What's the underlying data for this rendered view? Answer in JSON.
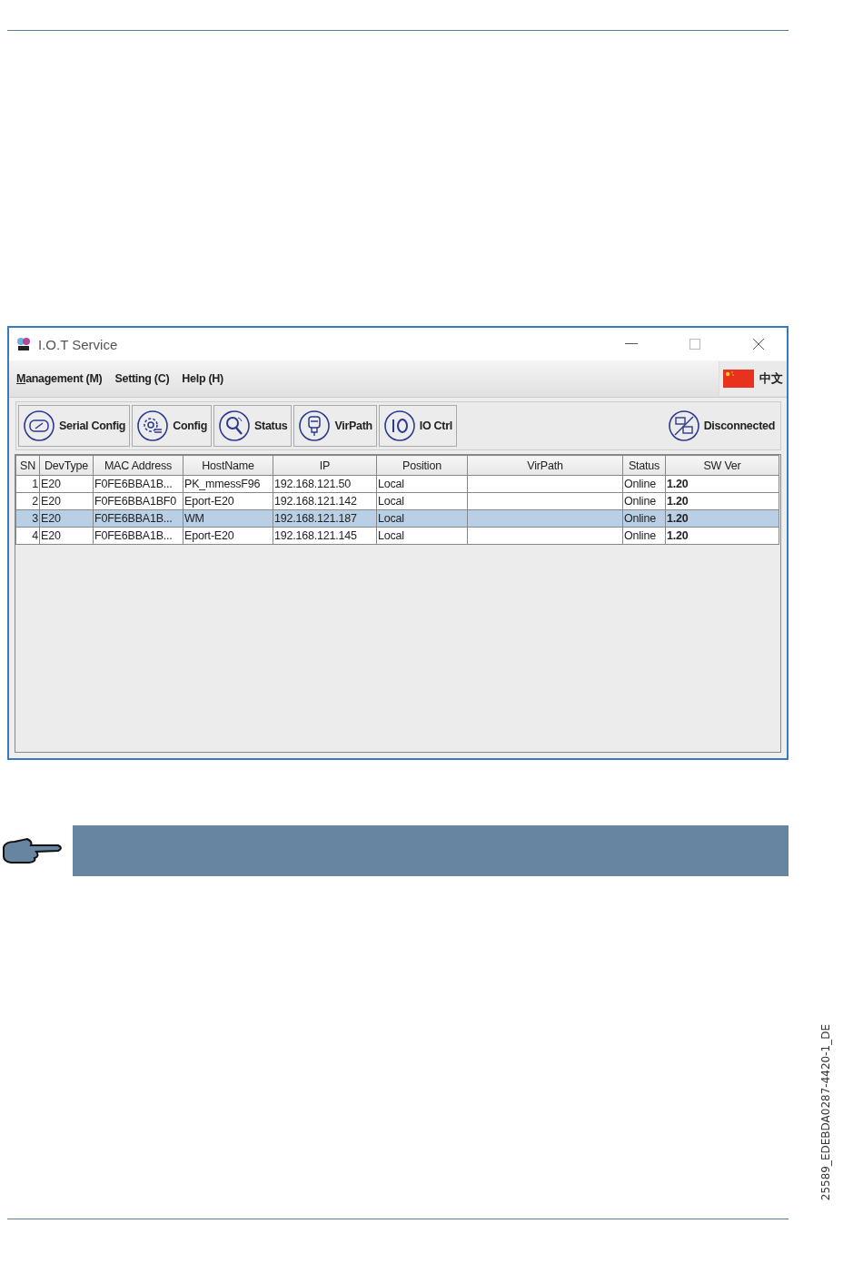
{
  "window": {
    "title": "I.O.T Service"
  },
  "menu": [
    {
      "label": "Management (M)",
      "underline_first": true
    },
    {
      "label": "Setting (C)",
      "underline_first": false
    },
    {
      "label": "Help (H)",
      "underline_first": false
    }
  ],
  "language": {
    "label": "中文"
  },
  "toolbar": [
    {
      "label": "Serial Config"
    },
    {
      "label": "Config"
    },
    {
      "label": "Status"
    },
    {
      "label": "VirPath"
    },
    {
      "label": "IO Ctrl"
    }
  ],
  "connection": {
    "label": "Disconnected"
  },
  "table": {
    "columns": [
      "SN",
      "DevType",
      "MAC Address",
      "HostName",
      "IP",
      "Position",
      "VirPath",
      "Status",
      "SW Ver"
    ],
    "rows": [
      {
        "cells": [
          "1",
          "E20",
          "F0FE6BBA1B...",
          "PK_mmessF96",
          "192.168.121.50",
          "Local",
          "",
          "Online",
          "1.20"
        ],
        "selected": false
      },
      {
        "cells": [
          "2",
          "E20",
          "F0FE6BBA1BF0",
          "Eport-E20",
          "192.168.121.142",
          "Local",
          "",
          "Online",
          "1.20"
        ],
        "selected": false
      },
      {
        "cells": [
          "3",
          "E20",
          "F0FE6BBA1B...",
          "WM",
          "192.168.121.187",
          "Local",
          "",
          "Online",
          "1.20"
        ],
        "selected": true
      },
      {
        "cells": [
          "4",
          "E20",
          "F0FE6BBA1B...",
          "Eport-E20",
          "192.168.121.145",
          "Local",
          "",
          "Online",
          "1.20"
        ],
        "selected": false
      }
    ]
  },
  "document_code": "25589_EDEBDA0287-4420-1_DE"
}
